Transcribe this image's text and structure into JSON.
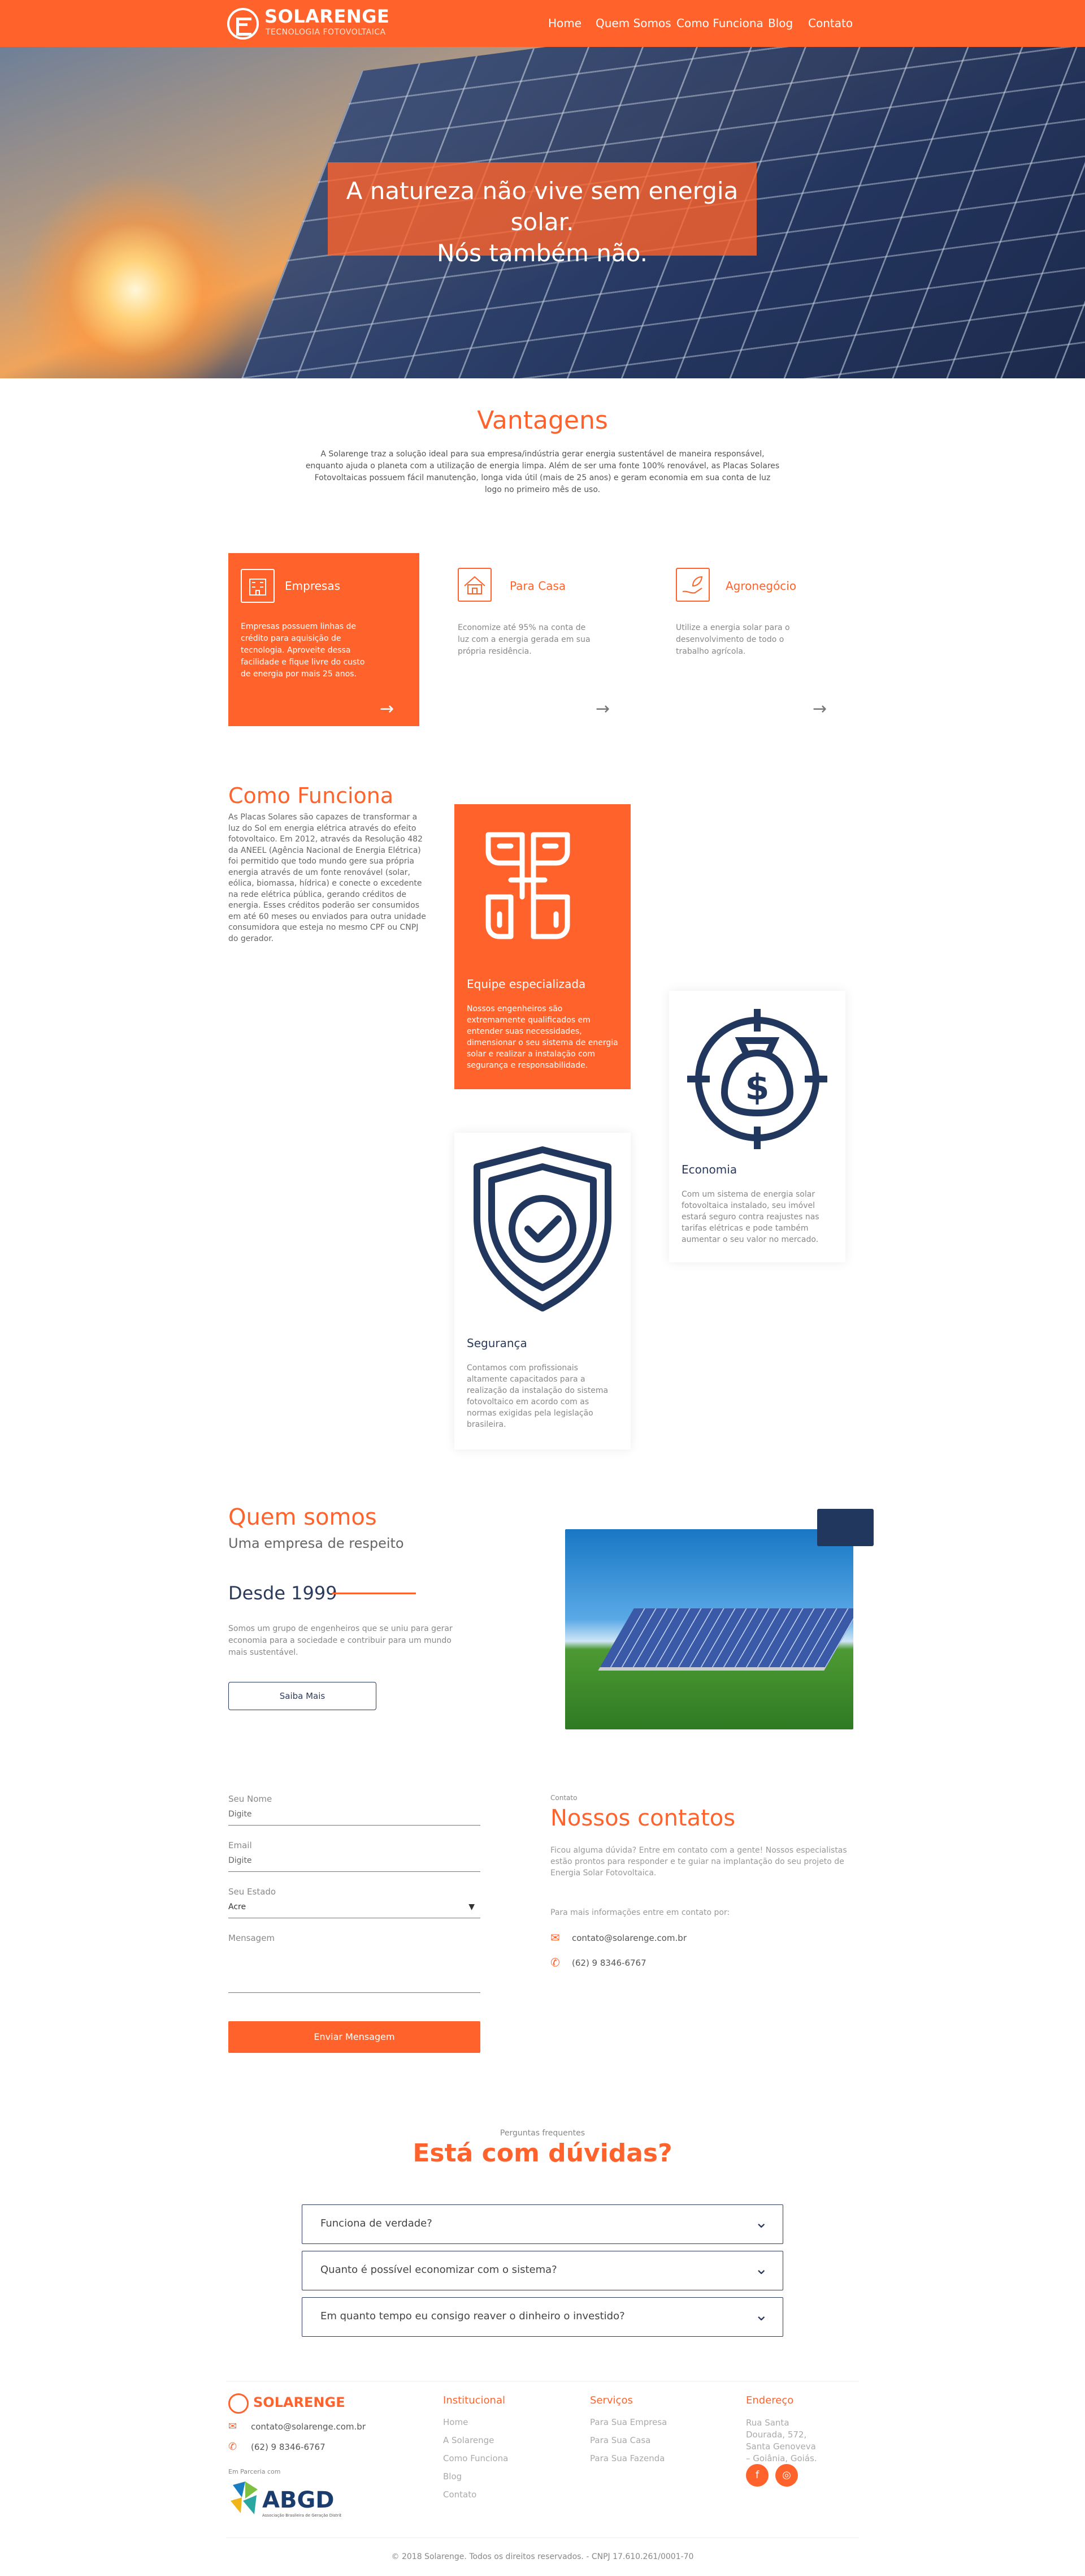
{
  "header": {
    "brand": "SOLARENGE",
    "tagline": "TECNOLOGIA FOTOVOLTAICA",
    "nav": [
      "Home",
      "Quem Somos",
      "Como Funciona",
      "Blog",
      "Contato"
    ]
  },
  "hero": {
    "line1": "A natureza não vive sem energia solar.",
    "line2": "Nós também não."
  },
  "vantagens": {
    "title": "Vantagens",
    "text": "A Solarenge traz a solução ideal para sua empresa/indústria gerar energia sustentável de maneira responsável, enquanto ajuda o planeta com a utilização de energia limpa. Além de ser uma fonte 100% renovável, as Placas Solares Fotovoltaicas possuem fácil manutenção, longa vida útil (mais de 25 anos) e geram economia em sua conta de luz logo no primeiro mês de uso.",
    "cards": [
      {
        "title": "Empresas",
        "text": "Empresas possuem linhas de crédito para aquisição de tecnologia. Aproveite dessa facilidade e fique livre do custo de energia por mais 25 anos.",
        "icon": "building-icon"
      },
      {
        "title": "Para Casa",
        "text": "Economize até 95% na conta de luz com a energia gerada em sua própria residência.",
        "icon": "house-icon"
      },
      {
        "title": "Agronegócio",
        "text": "Utilize a energia solar para o desenvolvimento de todo o trabalho agrícola.",
        "icon": "hand-leaf-icon"
      }
    ],
    "arrow": "→"
  },
  "como": {
    "title": "Como Funciona",
    "text": "As Placas Solares são capazes de transformar a luz do Sol em energia elétrica através do efeito fotovoltaico. Em 2012, através da Resolução 482 da ANEEL (Agência Nacional de Energia Elétrica) foi permitido que todo mundo gere sua própria energia através de um fonte renovável (solar, eólica, biomassa, hídrica) e conecte o excedente na rede elétrica pública, gerando créditos de energia. Esses créditos poderão ser consumidos em até 60 meses ou enviados para outra unidade consumidora que esteja no mesmo CPF ou CNPJ do gerador.",
    "features": [
      {
        "title": "Equipe especializada",
        "text": "Nossos engenheiros são extremamente qualificados em entender suas necessidades, dimensionar o seu sistema de energia solar e realizar a instalação com segurança e responsabilidade.",
        "icon": "hands-icon"
      },
      {
        "title": "Economia",
        "text": "Com um sistema de energia solar fotovoltaica instalado, seu imóvel estará seguro contra reajustes nas tarifas elétricas e pode também aumentar o seu valor no mercado.",
        "icon": "money-bag-target-icon"
      },
      {
        "title": "Segurança",
        "text": "Contamos com profissionais altamente capacitados para a realização da instalação do sistema fotovoltaico em acordo com as normas exigidas pela legislação brasileira.",
        "icon": "shield-check-icon"
      }
    ]
  },
  "quem": {
    "title": "Quem somos",
    "subtitle": "Uma empresa de respeito",
    "since": "Desde 1999",
    "text": "Somos um grupo de engenheiros que se uniu para gerar economia para a sociedade e contribuir para um mundo mais sustentável.",
    "button": "Saiba Mais"
  },
  "form": {
    "name_label": "Seu Nome",
    "name_ph": "Digite",
    "email_label": "Email",
    "email_ph": "Digite",
    "state_label": "Seu Estado",
    "state_value": "Acre",
    "message_label": "Mensagem",
    "send": "Enviar Mensagem"
  },
  "contatos": {
    "kicker": "Contato",
    "title": "Nossos contatos",
    "text": "Ficou alguma dúvida? Entre em contato com a gente! Nossos especialistas estão prontos para responder e te guiar na implantação do seu projeto de Energia Solar Fotovoltaica.",
    "more": "Para mais informações entre em contato por:",
    "email": "contato@solarenge.com.br",
    "phone": "(62) 9 8346-6767"
  },
  "faq": {
    "kicker": "Perguntas frequentes",
    "title": "Está com dúvidas?",
    "items": [
      "Funciona de verdade?",
      "Quanto é possível economizar com o sistema?",
      "Em quanto tempo eu consigo reaver o dinheiro o investido?"
    ]
  },
  "footer": {
    "brand": "SOLARENGE",
    "email": "contato@solarenge.com.br",
    "phone": "(62) 9 8346-6767",
    "partner_kicker": "Em Parceria com",
    "partner_name": "ABGD",
    "partner_sub": "Associação Brasileira de Geração Distribuída",
    "inst_title": "Institucional",
    "inst": [
      "Home",
      "A Solarenge",
      "Como Funciona",
      "Blog",
      "Contato"
    ],
    "serv_title": "Serviços",
    "serv": [
      "Para Sua Empresa",
      "Para Sua Casa",
      "Para Sua Fazenda"
    ],
    "end_title": "Endereço",
    "address": "Rua Santa Dourada, 572, Santa Genoveva – Goiânia, Goiás.",
    "copyright": "© 2018 Solarenge. Todos os direitos reservados. - CNPJ 17.610.261/0001-70"
  },
  "colors": {
    "accent": "#ff632b",
    "navy": "#2a3a5c"
  }
}
